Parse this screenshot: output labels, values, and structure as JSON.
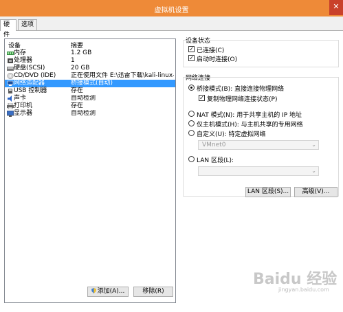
{
  "window": {
    "title": "虚拟机设置",
    "close_glyph": "✕"
  },
  "tabs": [
    {
      "label": "硬件"
    },
    {
      "label": "选项"
    }
  ],
  "device_list": {
    "col_device": "设备",
    "col_summary": "摘要",
    "rows": [
      {
        "name": "内存",
        "summary": "1.2 GB",
        "icon": "memory-icon"
      },
      {
        "name": "处理器",
        "summary": "1",
        "icon": "processor-icon"
      },
      {
        "name": "硬盘(SCSI)",
        "summary": "20 GB",
        "icon": "harddisk-icon"
      },
      {
        "name": "CD/DVD (IDE)",
        "summary": "正在使用文件 E:\\迅雷下载\\kali-linux-...",
        "icon": "cd-dvd-icon"
      },
      {
        "name": "网络适配器",
        "summary": "桥接模式(自动)",
        "icon": "network-adapter-icon",
        "selected": true
      },
      {
        "name": "USB 控制器",
        "summary": "存在",
        "icon": "usb-icon"
      },
      {
        "name": "声卡",
        "summary": "自动检测",
        "icon": "sound-card-icon"
      },
      {
        "name": "打印机",
        "summary": "存在",
        "icon": "printer-icon"
      },
      {
        "name": "显示器",
        "summary": "自动检测",
        "icon": "display-icon"
      }
    ]
  },
  "buttons": {
    "add": "添加(A)...",
    "remove": "移除(R)",
    "lan_segments": "LAN 区段(S)...",
    "advanced": "高级(V)..."
  },
  "device_status": {
    "title": "设备状态",
    "connected": {
      "label": "已连接(C)",
      "checked": true
    },
    "connect_on_power": {
      "label": "启动时连接(O)",
      "checked": true
    }
  },
  "network": {
    "title": "网络连接",
    "bridged": {
      "label": "桥接模式(B): 直接连接物理网络",
      "selected": true
    },
    "replicate": {
      "label": "复制物理网络连接状态(P)",
      "checked": true
    },
    "nat": {
      "label": "NAT 模式(N): 用于共享主机的 IP 地址"
    },
    "host_only": {
      "label": "仅主机模式(H): 与主机共享的专用网络"
    },
    "custom": {
      "label": "自定义(U): 特定虚拟网络",
      "value": "VMnet0"
    },
    "lan_segment": {
      "label": "LAN 区段(L):",
      "value": ""
    }
  },
  "colors": {
    "titlebar": "#ee8a38",
    "selection": "#3399ff",
    "close": "#c9412b"
  },
  "watermark": {
    "brand": "Baidu 经验",
    "url": "jingyan.baidu.com"
  }
}
